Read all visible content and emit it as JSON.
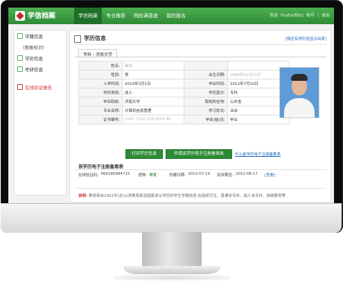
{
  "topbar": {
    "logo": "学信档案",
    "nav": [
      "学信档案",
      "专业推荐",
      "院校满意度",
      "我的报名"
    ],
    "right": [
      "欢迎",
      "hustsoftbiz",
      "帐号",
      "|",
      "退出"
    ]
  },
  "sidebar": {
    "items": [
      {
        "label": "学籍信息"
      },
      {
        "label": "(图像校对)"
      },
      {
        "label": "学历信息"
      },
      {
        "label": "考研信息"
      },
      {
        "label": "在线验证报告"
      }
    ]
  },
  "main": {
    "title": "学历信息",
    "header_link": "[我还有学历没显示出来]",
    "tab": "专科 - 济南大学",
    "rows": [
      {
        "left_label": "姓名:",
        "left_value": "秦昭",
        "right_label": "",
        "right_value": ""
      },
      {
        "left_label": "性别:",
        "left_value": "男",
        "right_label": "出生日期:",
        "right_value": "1988年01月02日"
      },
      {
        "left_label": "入学时间:",
        "left_value": "2010年3月1日",
        "right_label": "毕业时间:",
        "right_value": "2012年7月10日"
      },
      {
        "left_label": "学历类别:",
        "left_value": "成人",
        "right_label": "学历层次:",
        "right_value": "专科"
      },
      {
        "left_label": "毕业院校:",
        "left_value": "济南大学",
        "right_label": "院校所在地:",
        "right_value": "山东省"
      },
      {
        "left_label": "专业名称:",
        "left_value": "计算机信息管理",
        "right_label": "学习形式:",
        "right_value": "业余"
      },
      {
        "left_label": "证书编号:",
        "left_value": "1042 7520 128 0054 98",
        "right_label": "毕业(结)论:",
        "right_value": "毕业"
      }
    ],
    "buttons": {
      "print": "打印学历信息",
      "apply": "申请该学历电子注册备案表"
    },
    "what_link": "什么是学历电子注册备案表",
    "section_title": "该学历电子注册备案表",
    "code_label": "在线验证码:",
    "code_value": "066166984715",
    "lang_label": "语种:",
    "lang_value": "中文",
    "created_label": "创建日期:",
    "created_value": "2012-07-19",
    "expire_label": "有效期至:",
    "expire_value": "2012-08-17",
    "view_link": "[查看]",
    "notice_title": "说明:",
    "notice_text": "教育部自1991年(含)以来教育部及国家承认学历的学生学籍信息,包括研究生、普通本专科、成人本专科、网络教育等"
  },
  "colors": {
    "accent": "#2e8b35",
    "link": "#1565c0",
    "alert": "#d32f2f"
  }
}
